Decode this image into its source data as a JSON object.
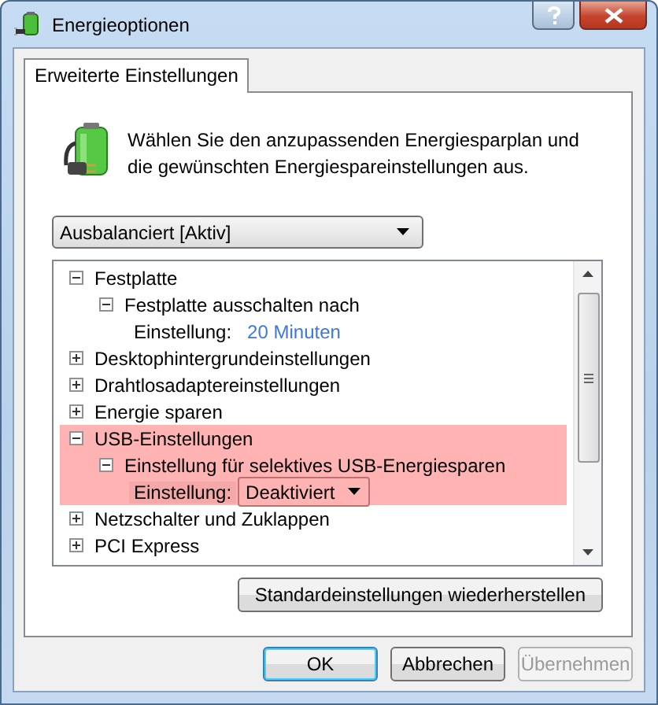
{
  "window": {
    "title": "Energieoptionen"
  },
  "tabs": [
    {
      "label": "Erweiterte Einstellungen",
      "selected": true
    }
  ],
  "description": "Wählen Sie den anzupassenden Energiesparplan und die gewünschten Energiespareinstellungen aus.",
  "plan_select": {
    "value": "Ausbalanciert [Aktiv]"
  },
  "tree": [
    {
      "kind": "group",
      "label": "Festplatte",
      "expanded": true,
      "highlighted": false,
      "children": [
        {
          "kind": "group",
          "label": "Festplatte ausschalten nach",
          "expanded": true,
          "highlighted": false,
          "children": [
            {
              "kind": "link_setting",
              "label": "Einstellung:",
              "value": "20 Minuten",
              "highlighted": false
            }
          ]
        }
      ]
    },
    {
      "kind": "group",
      "label": "Desktophintergrundeinstellungen",
      "expanded": false,
      "highlighted": false
    },
    {
      "kind": "group",
      "label": "Drahtlosadaptereinstellungen",
      "expanded": false,
      "highlighted": false
    },
    {
      "kind": "group",
      "label": "Energie sparen",
      "expanded": false,
      "highlighted": false
    },
    {
      "kind": "group",
      "label": "USB-Einstellungen",
      "expanded": true,
      "highlighted": true,
      "children": [
        {
          "kind": "group",
          "label": "Einstellung für selektives USB-Energiesparen",
          "expanded": true,
          "highlighted": true,
          "children": [
            {
              "kind": "dropdown_setting",
              "label": "Einstellung:",
              "value": "Deaktiviert",
              "highlighted": true
            }
          ]
        }
      ]
    },
    {
      "kind": "group",
      "label": "Netzschalter und Zuklappen",
      "expanded": false,
      "highlighted": false
    },
    {
      "kind": "group",
      "label": "PCI Express",
      "expanded": false,
      "highlighted": false
    }
  ],
  "restore_button": "Standardeinstellungen wiederherstellen",
  "buttons": [
    {
      "label": "OK",
      "default": true,
      "disabled": false
    },
    {
      "label": "Abbrechen",
      "default": false,
      "disabled": false
    },
    {
      "label": "Übernehmen",
      "default": false,
      "disabled": true
    }
  ]
}
